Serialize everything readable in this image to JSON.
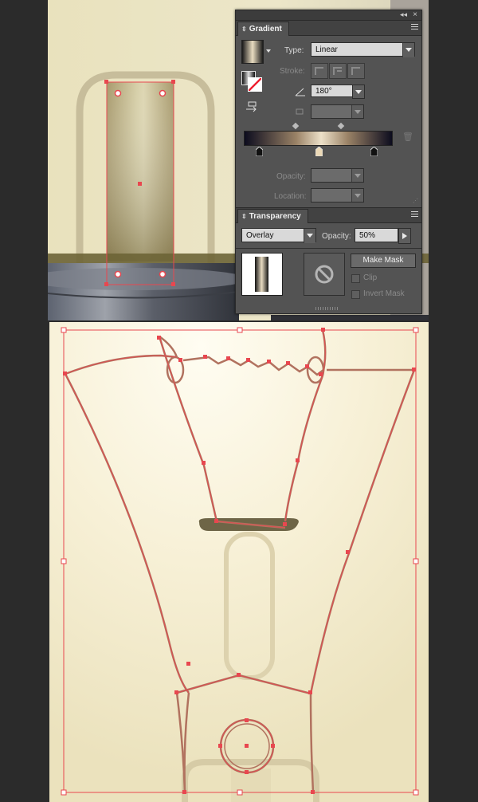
{
  "gradient_panel": {
    "title": "Gradient",
    "type_label": "Type:",
    "type_value": "Linear",
    "stroke_label": "Stroke:",
    "angle_value": "180°",
    "opacity_label": "Opacity:",
    "location_label": "Location:",
    "colors": {
      "dark": "#0c0c1e",
      "light": "#ece0c8",
      "mid": "#9a8266"
    }
  },
  "transparency_panel": {
    "title": "Transparency",
    "blend_mode": "Overlay",
    "opacity_label": "Opacity:",
    "opacity_value": "50%",
    "make_mask_label": "Make Mask",
    "clip_label": "Clip",
    "invert_mask_label": "Invert Mask"
  },
  "colors": {
    "selection": "#e8474f",
    "canvas_bg": "#f3ecd0",
    "panel_bg": "#535353"
  }
}
